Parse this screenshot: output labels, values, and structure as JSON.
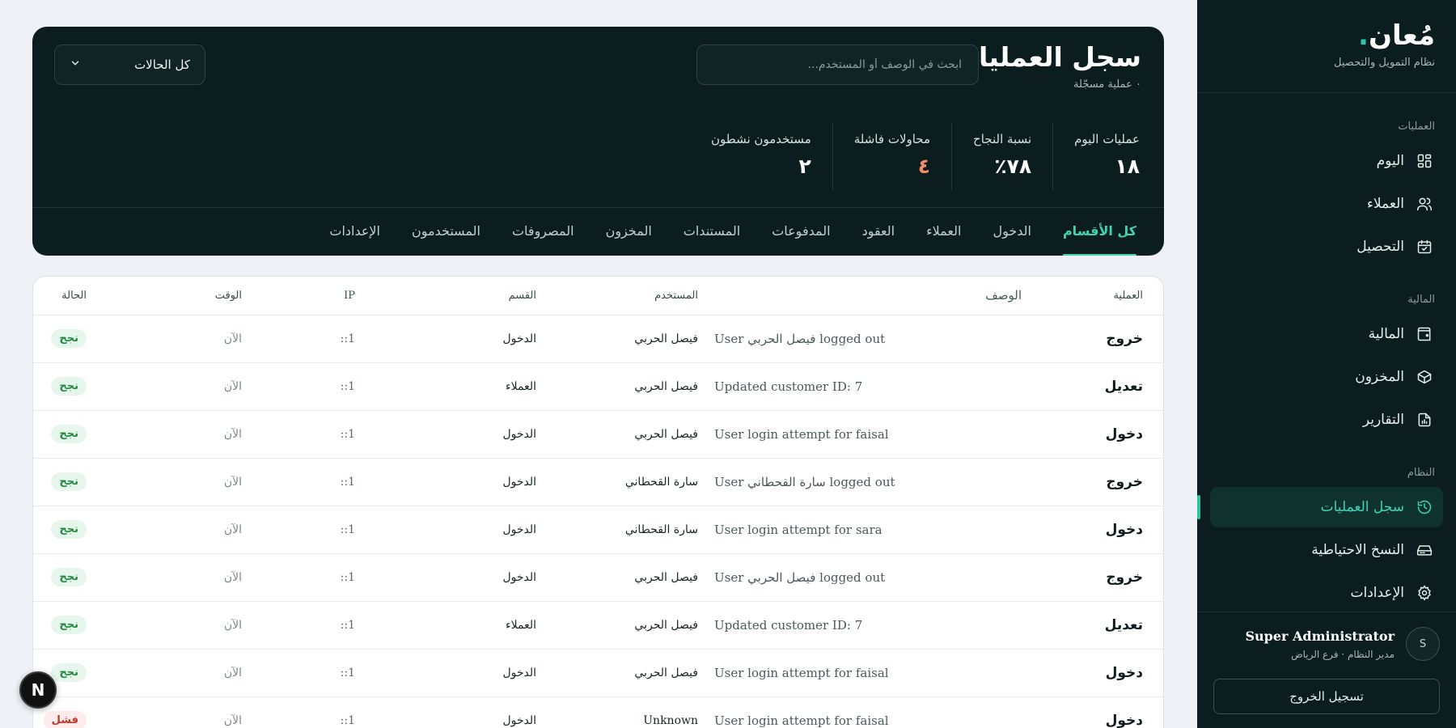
{
  "brand": {
    "logo": "مُعان",
    "logo_dot": ".",
    "subtitle": "نظام التمويل والتحصيل"
  },
  "sidebar": {
    "sections": [
      {
        "heading": "العمليات",
        "items": [
          {
            "label": "اليوم",
            "icon": "grid-icon"
          },
          {
            "label": "العملاء",
            "icon": "users-icon"
          },
          {
            "label": "التحصيل",
            "icon": "calendar-check-icon"
          }
        ]
      },
      {
        "heading": "المالية",
        "items": [
          {
            "label": "المالية",
            "icon": "wallet-icon"
          },
          {
            "label": "المخزون",
            "icon": "box-icon"
          },
          {
            "label": "التقارير",
            "icon": "report-icon"
          }
        ]
      },
      {
        "heading": "النظام",
        "items": [
          {
            "label": "سجل العمليات",
            "icon": "history-icon",
            "active": true
          },
          {
            "label": "النسخ الاحتياطية",
            "icon": "drive-icon"
          },
          {
            "label": "الإعدادات",
            "icon": "gear-icon"
          }
        ]
      }
    ]
  },
  "user": {
    "avatar": "S",
    "name": "Super Administrator",
    "role": "مدير النظام · فرع الرياض",
    "logout_label": "تسجيل الخروج"
  },
  "header": {
    "title": "سجل العمليات",
    "subtitle": "٠ عملية مسجّلة",
    "search_placeholder": "ابحث في الوصف أو المستخدم...",
    "status_filter": "كل الحالات",
    "stats": [
      {
        "label": "عمليات اليوم",
        "value": "١٨"
      },
      {
        "label": "نسبة النجاح",
        "value": "٧٨٪"
      },
      {
        "label": "محاولات فاشلة",
        "value": "٤",
        "danger": true
      },
      {
        "label": "مستخدمون نشطون",
        "value": "٢"
      }
    ],
    "tabs": [
      "كل الأقسام",
      "الدخول",
      "العملاء",
      "العقود",
      "المدفوعات",
      "المستندات",
      "المخزون",
      "المصروفات",
      "المستخدمون",
      "الإعدادات"
    ],
    "active_tab": 0
  },
  "table": {
    "columns": {
      "op": "العملية",
      "desc": "الوصف",
      "user": "المستخدم",
      "section": "القسم",
      "ip": "IP",
      "time": "الوقت",
      "status": "الحالة"
    },
    "rows": [
      {
        "op": "خروج",
        "desc": "User فيصل الحربي logged out",
        "user": "فيصل الحربي",
        "section": "الدخول",
        "ip": "::1",
        "time": "الآن",
        "status": "نجح",
        "ok": true
      },
      {
        "op": "تعديل",
        "desc": "Updated customer ID: 7",
        "user": "فيصل الحربي",
        "section": "العملاء",
        "ip": "::1",
        "time": "الآن",
        "status": "نجح",
        "ok": true
      },
      {
        "op": "دخول",
        "desc": "User login attempt for faisal",
        "user": "فيصل الحربي",
        "section": "الدخول",
        "ip": "::1",
        "time": "الآن",
        "status": "نجح",
        "ok": true
      },
      {
        "op": "خروج",
        "desc": "User سارة القحطاني logged out",
        "user": "سارة القحطاني",
        "section": "الدخول",
        "ip": "::1",
        "time": "الآن",
        "status": "نجح",
        "ok": true
      },
      {
        "op": "دخول",
        "desc": "User login attempt for sara",
        "user": "سارة القحطاني",
        "section": "الدخول",
        "ip": "::1",
        "time": "الآن",
        "status": "نجح",
        "ok": true
      },
      {
        "op": "خروج",
        "desc": "User فيصل الحربي logged out",
        "user": "فيصل الحربي",
        "section": "الدخول",
        "ip": "::1",
        "time": "الآن",
        "status": "نجح",
        "ok": true
      },
      {
        "op": "تعديل",
        "desc": "Updated customer ID: 7",
        "user": "فيصل الحربي",
        "section": "العملاء",
        "ip": "::1",
        "time": "الآن",
        "status": "نجح",
        "ok": true
      },
      {
        "op": "دخول",
        "desc": "User login attempt for faisal",
        "user": "فيصل الحربي",
        "section": "الدخول",
        "ip": "::1",
        "time": "الآن",
        "status": "نجح",
        "ok": true
      },
      {
        "op": "دخول",
        "desc": "User login attempt for faisal",
        "user": "Unknown",
        "section": "الدخول",
        "ip": "::1",
        "time": "الآن",
        "status": "فشل",
        "ok": false
      }
    ]
  },
  "dev_badge": "N",
  "colors": {
    "dark": "#0c1d1f",
    "accent": "#3fd3b3",
    "success": "#1f8a3e",
    "danger": "#c2372b"
  }
}
